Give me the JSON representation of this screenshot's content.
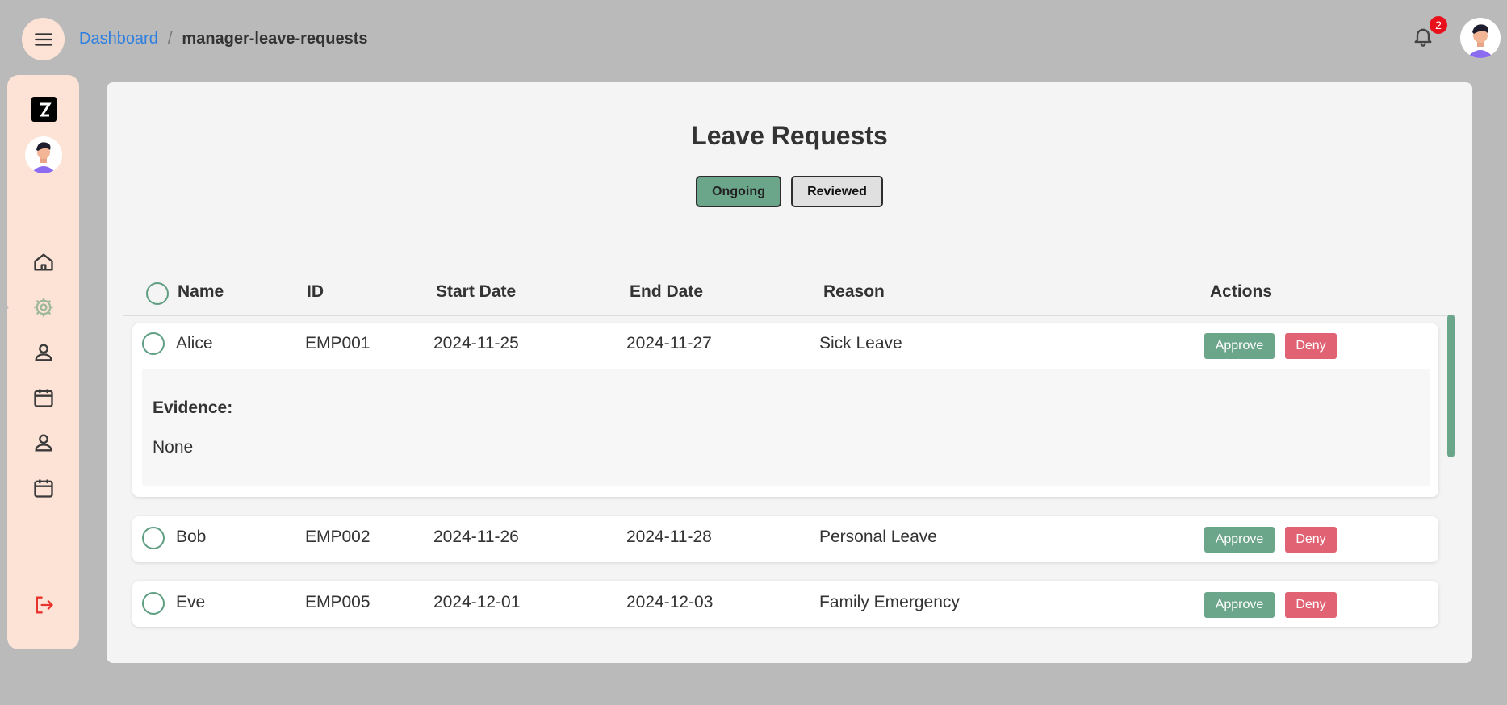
{
  "header": {
    "breadcrumb": {
      "home": "Dashboard",
      "separator": "/",
      "current": "manager-leave-requests"
    },
    "notification_count": "2",
    "menu_icon": "hamburger-menu-icon",
    "bell_icon": "bell-icon"
  },
  "sidebar": {
    "items": [
      {
        "name": "home",
        "icon": "home-icon"
      },
      {
        "name": "settings",
        "icon": "gear-icon",
        "active": true
      },
      {
        "name": "profile",
        "icon": "person-icon"
      },
      {
        "name": "calendar",
        "icon": "calendar-icon"
      },
      {
        "name": "employees",
        "icon": "person-icon"
      },
      {
        "name": "schedule",
        "icon": "calendar-icon"
      }
    ],
    "logout_icon": "logout-icon"
  },
  "page": {
    "title": "Leave Requests",
    "tabs": [
      {
        "label": "Ongoing",
        "active": true
      },
      {
        "label": "Reviewed",
        "active": false
      }
    ]
  },
  "table": {
    "columns": [
      "Name",
      "ID",
      "Start Date",
      "End Date",
      "Reason",
      "Actions"
    ],
    "rows": [
      {
        "name": "Alice",
        "id": "EMP001",
        "start": "2024-11-25",
        "end": "2024-11-27",
        "reason": "Sick Leave",
        "expanded": true,
        "evidence_label": "Evidence:",
        "evidence_value": "None"
      },
      {
        "name": "Bob",
        "id": "EMP002",
        "start": "2024-11-26",
        "end": "2024-11-28",
        "reason": "Personal Leave"
      },
      {
        "name": "Eve",
        "id": "EMP005",
        "start": "2024-12-01",
        "end": "2024-12-03",
        "reason": "Family Emergency"
      }
    ],
    "approve_label": "Approve",
    "deny_label": "Deny"
  },
  "colors": {
    "accent_green": "#6ba58a",
    "deny_red": "#e06273",
    "sidebar_bg": "#fde3d6",
    "link_blue": "#2e7fe0",
    "badge_red": "#e8111b"
  }
}
